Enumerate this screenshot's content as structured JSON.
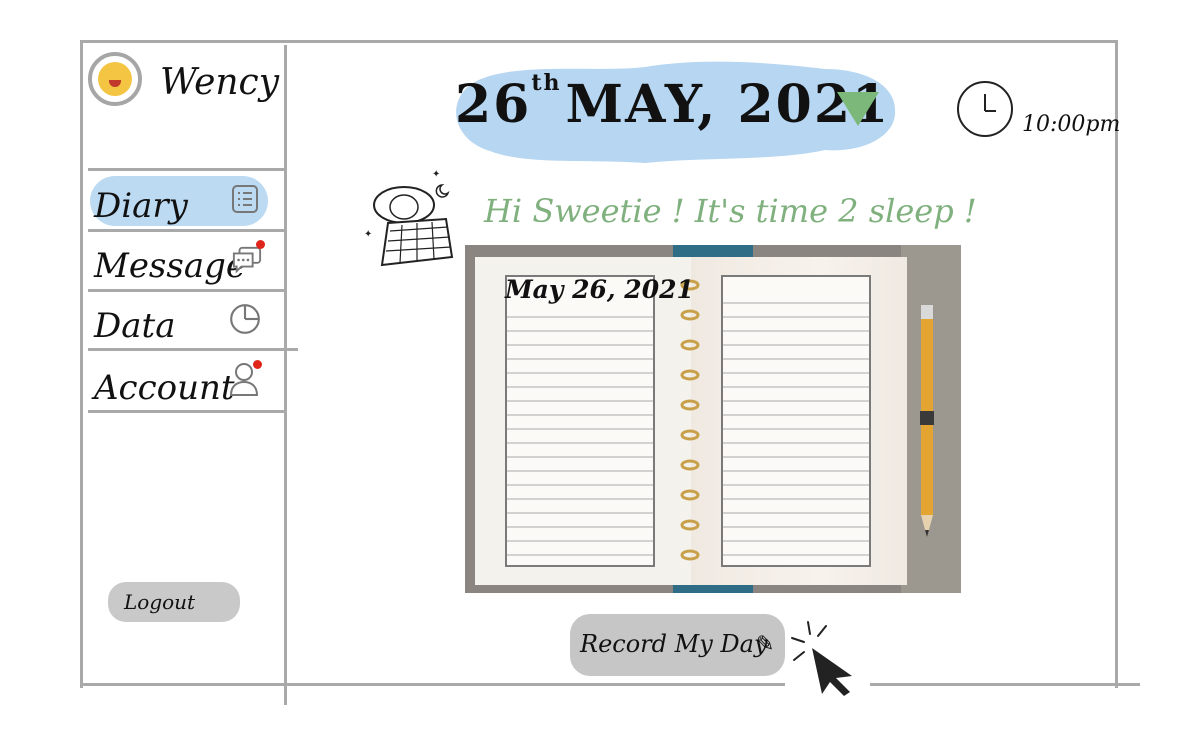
{
  "user": {
    "name": "Wency",
    "avatar_icon": "raised-hands-emoji-icon"
  },
  "sidebar": {
    "items": [
      {
        "label": "Diary",
        "icon": "notes-icon",
        "active": true,
        "badge": false
      },
      {
        "label": "Message",
        "icon": "chat-bubbles-icon",
        "active": false,
        "badge": true
      },
      {
        "label": "Data",
        "icon": "pie-chart-icon",
        "active": false,
        "badge": false
      },
      {
        "label": "Account",
        "icon": "person-icon",
        "active": false,
        "badge": true
      }
    ],
    "logout_label": "Logout"
  },
  "header": {
    "date_day": "26",
    "date_suffix": "th",
    "date_rest": "MAY, 2021",
    "time": "10:00pm"
  },
  "greeting": "Hi Sweetie ! It's time 2 sleep !",
  "journal": {
    "date": "May 26, 2021"
  },
  "record_button_label": "Record My Day",
  "colors": {
    "highlight_blue": "#b6d6f2",
    "greeting_green": "#7fb07e",
    "dropdown_green": "#7cb87a",
    "badge_red": "#e0261b",
    "button_gray": "#c6c6c6"
  }
}
